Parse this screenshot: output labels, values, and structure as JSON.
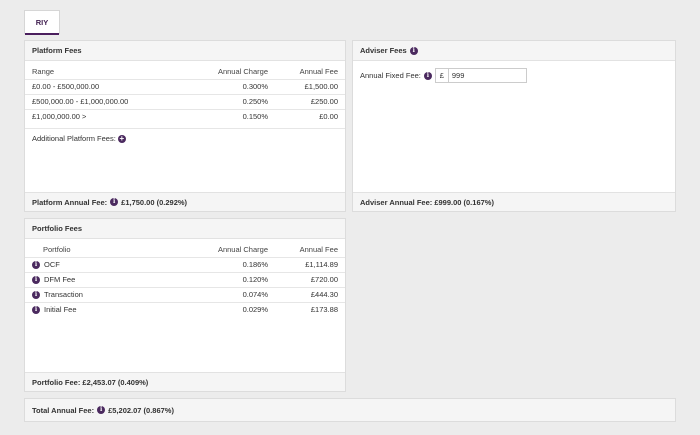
{
  "tabs": [
    {
      "label": "RIY"
    }
  ],
  "platform": {
    "title": "Platform Fees",
    "columns": [
      "Range",
      "Annual Charge",
      "Annual Fee"
    ],
    "rows": [
      {
        "range": "£0.00 - £500,000.00",
        "charge": "0.300%",
        "fee": "£1,500.00"
      },
      {
        "range": "£500,000.00 - £1,000,000.00",
        "charge": "0.250%",
        "fee": "£250.00"
      },
      {
        "range": "£1,000,000.00 >",
        "charge": "0.150%",
        "fee": "£0.00"
      }
    ],
    "additional_label": "Additional Platform Fees:",
    "footer_label": "Platform Annual Fee:",
    "footer_value": "£1,750.00 (0.292%)"
  },
  "adviser": {
    "title": "Adviser Fees",
    "fixed_label": "Annual Fixed Fee:",
    "currency": "£",
    "fixed_value": "999",
    "footer_text": "Adviser Annual Fee: £999.00 (0.167%)"
  },
  "portfolio": {
    "title": "Portfolio Fees",
    "columns": [
      "Portfolio",
      "Annual Charge",
      "Annual Fee"
    ],
    "rows": [
      {
        "name": "OCF",
        "charge": "0.186%",
        "fee": "£1,114.89"
      },
      {
        "name": "DFM Fee",
        "charge": "0.120%",
        "fee": "£720.00"
      },
      {
        "name": "Transaction",
        "charge": "0.074%",
        "fee": "£444.30"
      },
      {
        "name": "Initial Fee",
        "charge": "0.029%",
        "fee": "£173.88"
      }
    ],
    "footer_text": "Portfolio Fee: £2,453.07 (0.409%)"
  },
  "total": {
    "label": "Total Annual Fee:",
    "value": "£5,202.07 (0.867%)"
  },
  "icons": {
    "info": "info-icon",
    "add": "plus-circle-icon"
  },
  "colors": {
    "accent": "#4b2a5f"
  }
}
